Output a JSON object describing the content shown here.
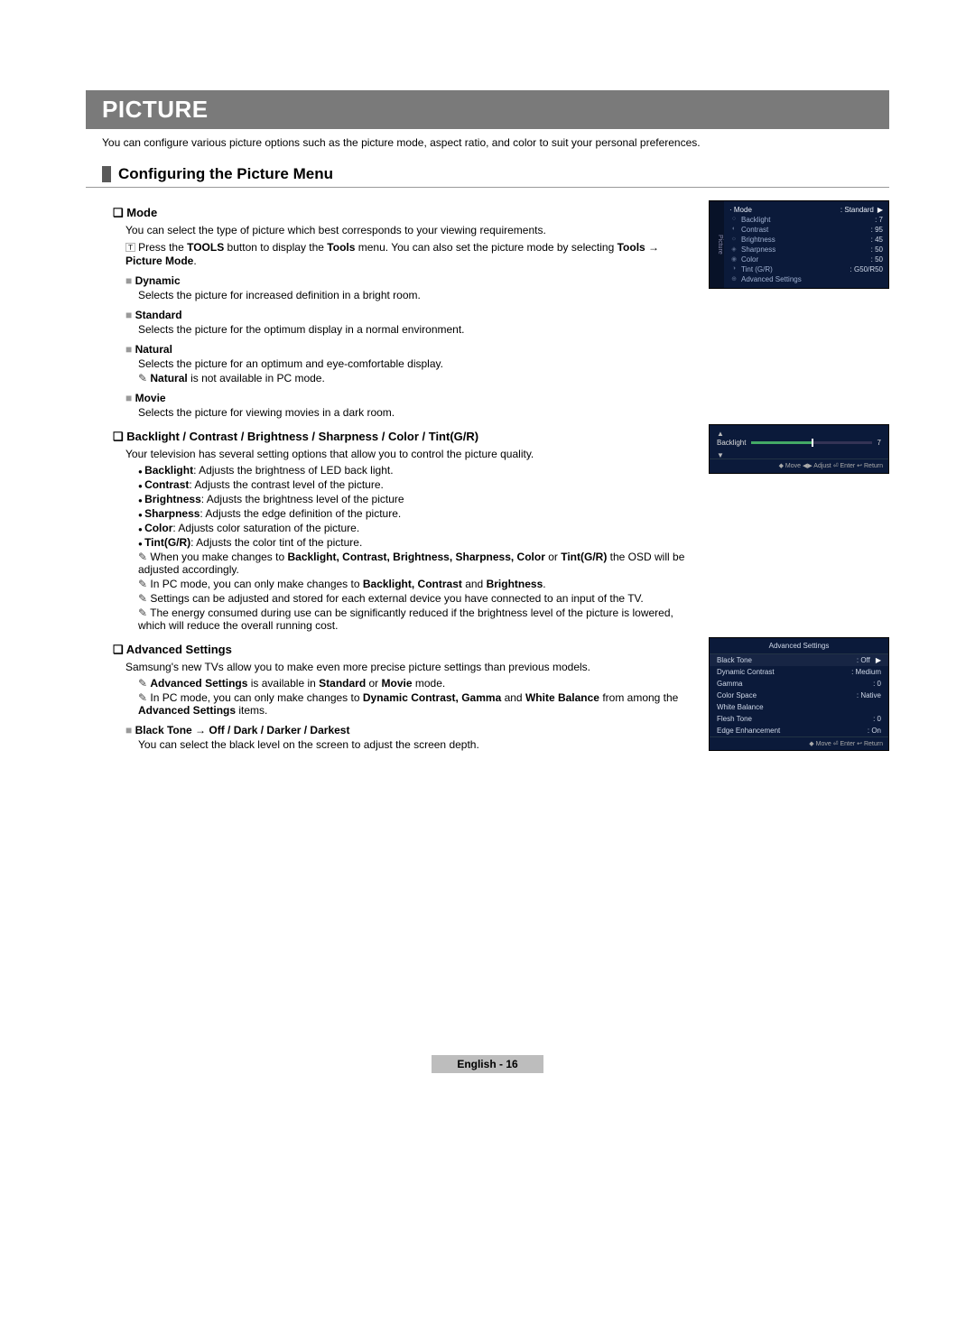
{
  "title": "PICTURE",
  "intro": "You can configure various picture options such as the picture mode, aspect ratio, and color to suit your personal preferences.",
  "section_title": "Configuring the Picture Menu",
  "mode": {
    "heading": "Mode",
    "intro": "You can select the type of picture which best corresponds to your viewing requirements.",
    "tool_prefix": "Press the ",
    "tool_bold1": "TOOLS",
    "tool_mid": " button to display the ",
    "tool_bold2": "Tools",
    "tool_suffix": " menu. You can also set the picture mode by selecting ",
    "tool_bold3": "Tools → Picture Mode",
    "tool_end": ".",
    "dynamic_h": "Dynamic",
    "dynamic_t": "Selects the picture for increased definition in a bright room.",
    "standard_h": "Standard",
    "standard_t": "Selects the picture for the optimum display in a normal environment.",
    "natural_h": "Natural",
    "natural_t": "Selects the picture for an optimum and eye-comfortable display.",
    "natural_note_b": "Natural",
    "natural_note_t": " is not available in PC mode.",
    "movie_h": "Movie",
    "movie_t": "Selects the picture for viewing movies in a dark room."
  },
  "bcb": {
    "heading": "Backlight / Contrast / Brightness / Sharpness / Color / Tint(G/R)",
    "intro": "Your television has several setting options that allow you to control the picture quality.",
    "b1_b": "Backlight",
    "b1_t": ": Adjusts the brightness of LED back light.",
    "b2_b": "Contrast",
    "b2_t": ": Adjusts the contrast level of the picture.",
    "b3_b": "Brightness",
    "b3_t": ": Adjusts the brightness level of the picture",
    "b4_b": "Sharpness",
    "b4_t": ": Adjusts the edge definition of the picture.",
    "b5_b": "Color",
    "b5_t": ": Adjusts color saturation of the picture.",
    "b6_b": "Tint(G/R)",
    "b6_t": ": Adjusts the color tint of the picture.",
    "n1_a": "When you make changes to ",
    "n1_b": "Backlight, Contrast, Brightness, Sharpness, Color",
    "n1_c": " or ",
    "n1_d": "Tint(G/R)",
    "n1_e": " the OSD will be adjusted accordingly.",
    "n2_a": "In PC mode, you can only make changes to ",
    "n2_b": "Backlight, Contrast",
    "n2_c": " and ",
    "n2_d": "Brightness",
    "n2_e": ".",
    "n3": "Settings can be adjusted and stored for each external device you have connected to an input of the TV.",
    "n4": "The energy consumed during use can be significantly reduced if the brightness level of the picture is lowered, which will reduce the overall running cost."
  },
  "adv": {
    "heading": "Advanced Settings",
    "intro": "Samsung's new TVs allow you to make even more precise picture settings than previous models.",
    "n1_b": "Advanced Settings",
    "n1_mid": " is available in ",
    "n1_b2": "Standard",
    "n1_or": " or ",
    "n1_b3": "Movie",
    "n1_end": " mode.",
    "n2_a": "In PC mode, you can only make changes to ",
    "n2_b": "Dynamic Contrast, Gamma",
    "n2_c": " and ",
    "n2_d": "White Balance",
    "n2_e": " from among the ",
    "n2_f": "Advanced Settings",
    "n2_g": " items.",
    "bt_h": "Black Tone → Off / Dark / Darker / Darkest",
    "bt_t": "You can select the black level on the screen to adjust the screen depth."
  },
  "osd1": {
    "tab": "Picture",
    "rows": [
      {
        "k": "· Mode",
        "v": ": Standard"
      },
      {
        "k": "Backlight",
        "v": ": 7"
      },
      {
        "k": "Contrast",
        "v": ": 95"
      },
      {
        "k": "Brightness",
        "v": ": 45"
      },
      {
        "k": "Sharpness",
        "v": ": 50"
      },
      {
        "k": "Color",
        "v": ": 50"
      },
      {
        "k": "Tint (G/R)",
        "v": ": G50/R50"
      },
      {
        "k": "Advanced Settings",
        "v": ""
      }
    ],
    "arrow": "▶"
  },
  "osd2": {
    "up": "▲",
    "down": "▼",
    "label": "Backlight",
    "value": "7",
    "footer": "◆ Move   ◀▶ Adjust   ⏎ Enter   ↩ Return"
  },
  "osd3": {
    "title": "Advanced Settings",
    "rows": [
      {
        "k": "Black Tone",
        "v": ": Off"
      },
      {
        "k": "Dynamic Contrast",
        "v": ": Medium"
      },
      {
        "k": "Gamma",
        "v": ": 0"
      },
      {
        "k": "Color Space",
        "v": ": Native"
      },
      {
        "k": "White Balance",
        "v": ""
      },
      {
        "k": "Flesh Tone",
        "v": ": 0"
      },
      {
        "k": "Edge Enhancement",
        "v": ": On"
      }
    ],
    "arrow": "▶",
    "footer": "◆ Move   ⏎ Enter   ↩ Return"
  },
  "footer": "English - 16"
}
